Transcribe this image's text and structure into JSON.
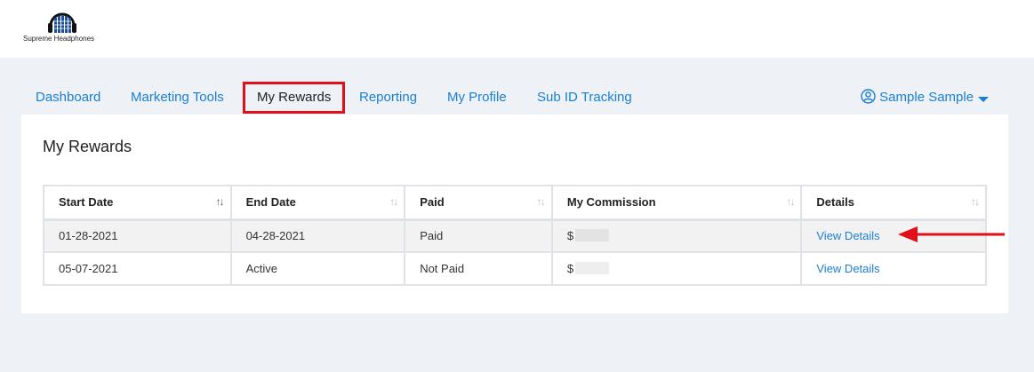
{
  "brand": {
    "name": "Supreme Headphones",
    "logo_icon": "headphones-equalizer-icon"
  },
  "nav": {
    "items": [
      {
        "label": "Dashboard"
      },
      {
        "label": "Marketing Tools"
      },
      {
        "label": "My Rewards",
        "active": true
      },
      {
        "label": "Reporting"
      },
      {
        "label": "My Profile"
      },
      {
        "label": "Sub ID Tracking"
      }
    ],
    "user": {
      "name": "Sample Sample",
      "icon": "user-circle-icon",
      "dropdown_icon": "caret-down-icon"
    }
  },
  "page": {
    "title": "My Rewards"
  },
  "table": {
    "columns": [
      "Start Date",
      "End Date",
      "Paid",
      "My Commission",
      "Details"
    ],
    "rows": [
      {
        "start": "01-28-2021",
        "end": "04-28-2021",
        "paid": "Paid",
        "commission": "$",
        "details": "View Details"
      },
      {
        "start": "05-07-2021",
        "end": "Active",
        "paid": "Not Paid",
        "commission": "$",
        "details": "View Details"
      }
    ]
  },
  "annotation": {
    "arrow_color": "#e0101a"
  },
  "colors": {
    "link": "#1a7fd4",
    "highlight": "#e0101a",
    "background": "#eef1f5"
  }
}
